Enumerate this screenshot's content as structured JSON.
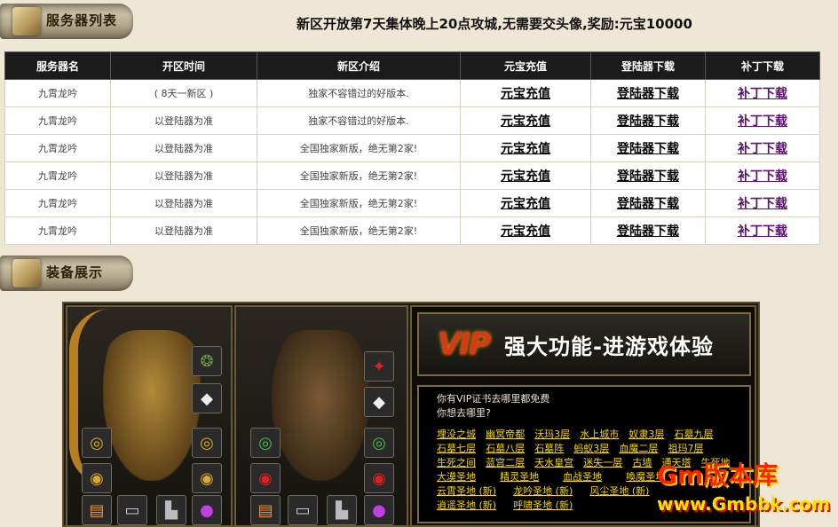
{
  "banner1": "服务器列表",
  "announcement": "新区开放第7天集体晚上20点攻城,无需要交头像,奖励:元宝10000",
  "table": {
    "headers": [
      "服务器名",
      "开区时间",
      "新区介绍",
      "元宝充值",
      "登陆器下载",
      "补丁下载"
    ],
    "rows": [
      [
        "九霄龙吟",
        "( 8天一新区 )",
        "独家不容错过的好版本.",
        "元宝充值",
        "登陆器下载",
        "补丁下载"
      ],
      [
        "九霄龙吟",
        "以登陆器为准",
        "独家不容错过的好版本.",
        "元宝充值",
        "登陆器下载",
        "补丁下载"
      ],
      [
        "九霄龙吟",
        "以登陆器为准",
        "全国独家新版，绝无第2家!",
        "元宝充值",
        "登陆器下载",
        "补丁下载"
      ],
      [
        "九霄龙吟",
        "以登陆器为准",
        "全国独家新版，绝无第2家!",
        "元宝充值",
        "登陆器下载",
        "补丁下载"
      ],
      [
        "九霄龙吟",
        "以登陆器为准",
        "全国独家新版，绝无第2家!",
        "元宝充值",
        "登陆器下载",
        "补丁下载"
      ],
      [
        "九霄龙吟",
        "以登陆器为准",
        "全国独家新版，绝无第2家!",
        "元宝充值",
        "登陆器下载",
        "补丁下载"
      ]
    ]
  },
  "banner2": "装备展示",
  "vip": {
    "logo": "VIP",
    "title": "强大功能-进游戏体验",
    "line1": "你有VIP证书去哪里都免费",
    "line2": "你想去哪里?",
    "maps": [
      [
        "埋没之城",
        "幽冥帝都",
        "沃玛3层",
        "水上城市",
        "奴隶3层",
        "石墓九层"
      ],
      [
        "石墓七层",
        "石墓八层",
        "石墓阵",
        "蚂蚁3层",
        "血魔二层",
        "祖玛7层"
      ],
      [
        "生死之间",
        "蓝宫二层",
        "天水皇宫",
        "迷失一层",
        "古墙",
        "通天塔",
        "牛死地"
      ],
      [
        "大漠圣地",
        "精灵圣地",
        "血战圣地",
        "喚魔圣地"
      ],
      [
        "云霄圣地 (新)",
        "龙吟圣地 (新)",
        "风尘圣地 (新)"
      ],
      [
        "逍遥圣地 (新)",
        "呼啸圣地 (新)"
      ]
    ]
  },
  "watermark": {
    "top": "Gm版本库",
    "bottom": "www.Gmbbk.com"
  },
  "colors": {
    "accent": "#f4d800",
    "header": "#1b1b1b",
    "patch_link": "#5a1170"
  }
}
